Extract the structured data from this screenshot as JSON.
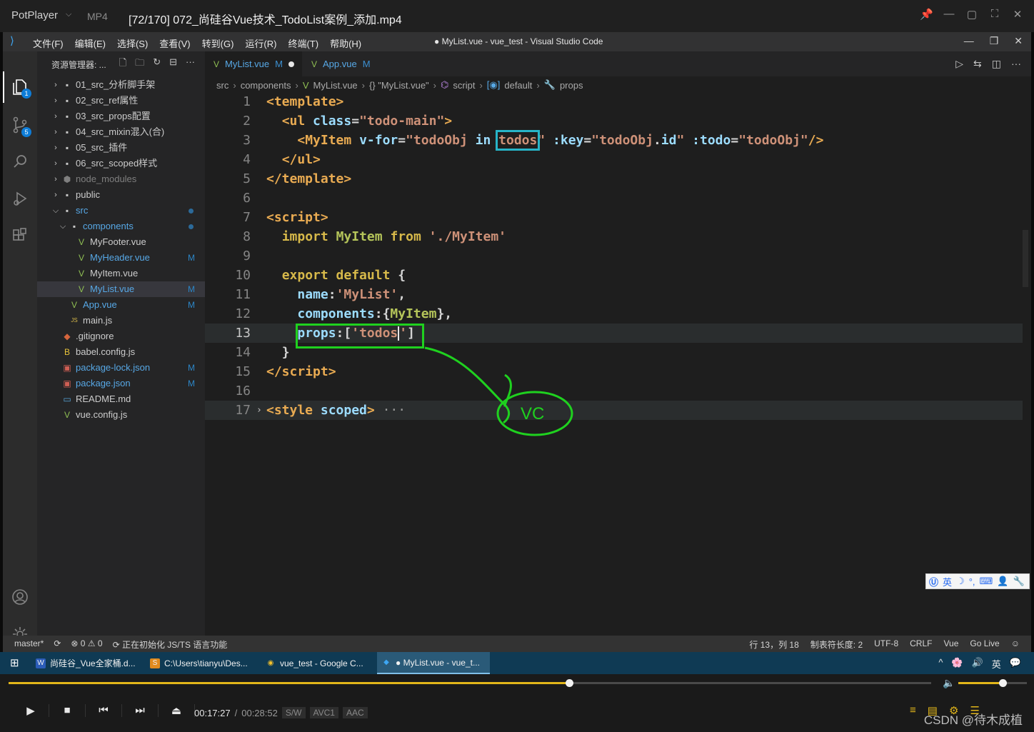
{
  "player": {
    "brand": "PotPlayer",
    "format": "MP4",
    "file_title": "[72/170] 072_尚硅谷Vue技术_TodoList案例_添加.mp4",
    "window_buttons": [
      "📌",
      "—",
      "▢",
      "⛶",
      "✕"
    ]
  },
  "vscode": {
    "menu": [
      "文件(F)",
      "编辑(E)",
      "选择(S)",
      "查看(V)",
      "转到(G)",
      "运行(R)",
      "终端(T)",
      "帮助(H)"
    ],
    "window_title": "● MyList.vue - vue_test - Visual Studio Code",
    "activity_badges": {
      "explorer": "1",
      "scm": "5"
    },
    "explorer": {
      "title": "资源管理器: ...",
      "tree": [
        {
          "label": "01_src_分析脚手架",
          "type": "folder",
          "depth": 0,
          "open": false
        },
        {
          "label": "02_src_ref属性",
          "type": "folder",
          "depth": 0,
          "open": false
        },
        {
          "label": "03_src_props配置",
          "type": "folder",
          "depth": 0,
          "open": false
        },
        {
          "label": "04_src_mixin混入(合)",
          "type": "folder",
          "depth": 0,
          "open": false
        },
        {
          "label": "05_src_插件",
          "type": "folder",
          "depth": 0,
          "open": false
        },
        {
          "label": "06_src_scoped样式",
          "type": "folder",
          "depth": 0,
          "open": false
        },
        {
          "label": "node_modules",
          "type": "folder-node",
          "depth": 0,
          "open": false
        },
        {
          "label": "public",
          "type": "folder",
          "depth": 0,
          "open": false
        },
        {
          "label": "src",
          "type": "folder",
          "depth": 0,
          "open": true,
          "color": "blue",
          "dot": true
        },
        {
          "label": "components",
          "type": "folder",
          "depth": 1,
          "open": true,
          "color": "blue",
          "dot": true
        },
        {
          "label": "MyFooter.vue",
          "type": "vue",
          "depth": 2
        },
        {
          "label": "MyHeader.vue",
          "type": "vue",
          "depth": 2,
          "color": "blue",
          "status": "M"
        },
        {
          "label": "MyItem.vue",
          "type": "vue",
          "depth": 2
        },
        {
          "label": "MyList.vue",
          "type": "vue",
          "depth": 2,
          "color": "blue",
          "status": "M",
          "selected": true
        },
        {
          "label": "App.vue",
          "type": "vue",
          "depth": 1,
          "color": "blue",
          "status": "M"
        },
        {
          "label": "main.js",
          "type": "js",
          "depth": 1
        },
        {
          "label": ".gitignore",
          "type": "git",
          "depth": 0
        },
        {
          "label": "babel.config.js",
          "type": "babel",
          "depth": 0
        },
        {
          "label": "package-lock.json",
          "type": "json",
          "depth": 0,
          "color": "blue",
          "status": "M"
        },
        {
          "label": "package.json",
          "type": "json",
          "depth": 0,
          "color": "blue",
          "status": "M"
        },
        {
          "label": "README.md",
          "type": "md",
          "depth": 0
        },
        {
          "label": "vue.config.js",
          "type": "vue",
          "depth": 0
        }
      ]
    },
    "tabs": [
      {
        "label": "MyList.vue",
        "status": "M",
        "dirty": true,
        "active": true
      },
      {
        "label": "App.vue",
        "status": "M",
        "dirty": false,
        "active": false
      }
    ],
    "breadcrumbs": [
      "src",
      "components",
      "MyList.vue",
      "{} \"MyList.vue\"",
      "script",
      "default",
      "props"
    ],
    "line_numbers": [
      "1",
      "2",
      "3",
      "4",
      "5",
      "6",
      "7",
      "8",
      "9",
      "10",
      "11",
      "12",
      "13",
      "14",
      "15",
      "16",
      "17"
    ],
    "current_line": 13,
    "annotation": "VC",
    "status_bar": {
      "left": [
        "master*",
        "⟳",
        "⊗ 0 ⚠ 0",
        "⟳ 正在初始化 JS/TS 语言功能"
      ],
      "right": [
        "行 13，列 18",
        "制表符长度: 2",
        "UTF-8",
        "CRLF",
        "Vue",
        "Go Live"
      ]
    },
    "ime": [
      "英",
      "☽",
      "°,",
      "⌨",
      "👤",
      "🔧"
    ]
  },
  "taskbar": {
    "items": [
      {
        "label": "尚硅谷_Vue全家桶.d...",
        "icon": "W",
        "icon_color": "#2b5cb8",
        "active": false
      },
      {
        "label": "C:\\Users\\tianyu\\Des...",
        "icon": "S",
        "icon_color": "#e08a1e",
        "active": false
      },
      {
        "label": "vue_test - Google C...",
        "icon": "◉",
        "icon_color": "#3a8f3a",
        "active": false
      },
      {
        "label": "● MyList.vue - vue_t...",
        "icon": "◆",
        "icon_color": "#2a8ad8",
        "active": true
      }
    ],
    "tray": [
      "^",
      "🌸",
      "🔊",
      "英",
      "💬"
    ]
  },
  "controls": {
    "progress_fraction": 0.6076,
    "volume_fraction": 0.65,
    "current_time": "00:17:27",
    "total_time": "00:28:52",
    "tags": [
      "S/W",
      "AVC1",
      "AAC"
    ],
    "buttons": [
      "▶",
      "■",
      "⏮",
      "⏭",
      "⏏"
    ],
    "watermark": "CSDN @待木成植"
  }
}
